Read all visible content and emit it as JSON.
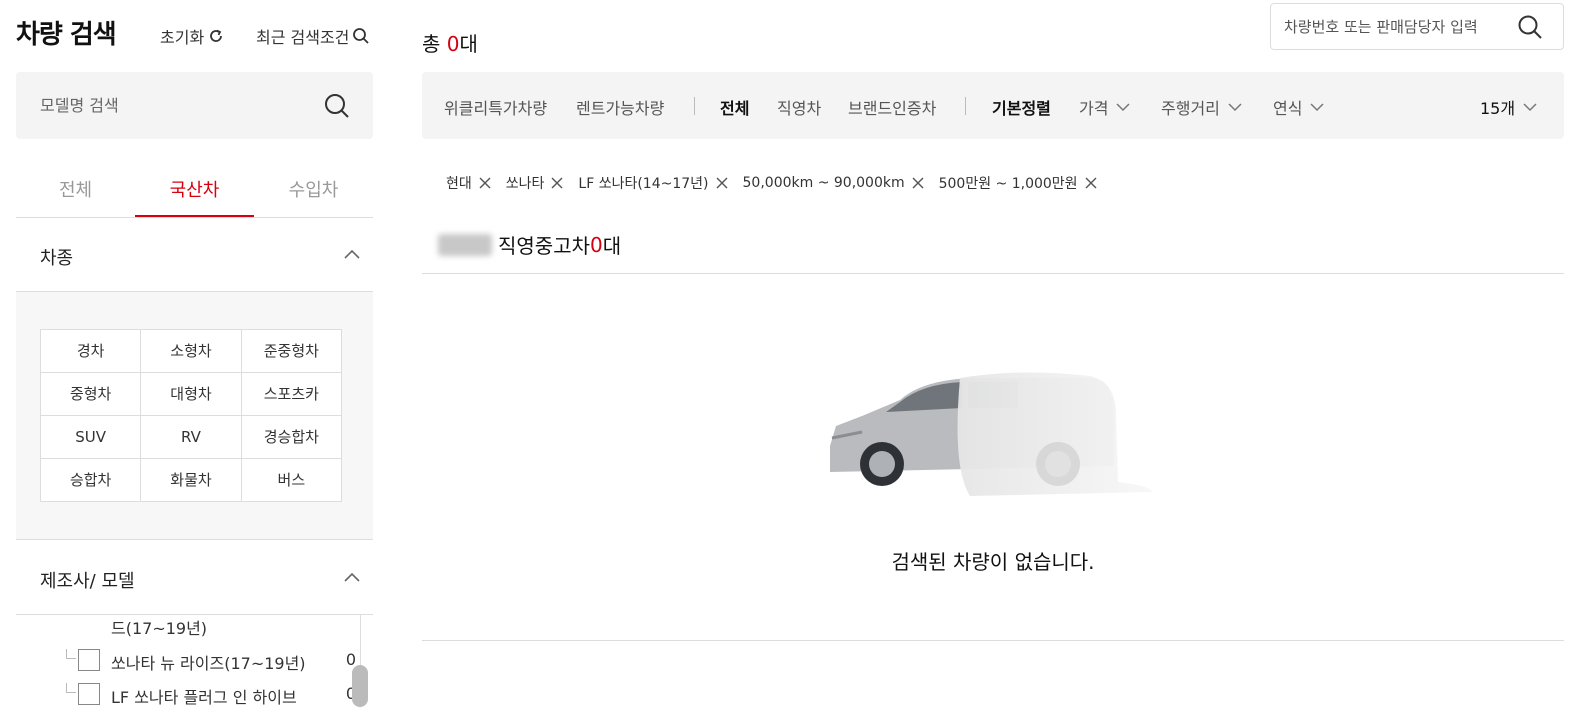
{
  "sidebar": {
    "title": "차량 검색",
    "reset_label": "초기화",
    "recent_label": "최근 검색조건",
    "model_search_placeholder": "모델명 검색",
    "origin_tabs": [
      {
        "label": "전체",
        "active": false
      },
      {
        "label": "국산차",
        "active": true
      },
      {
        "label": "수입차",
        "active": false
      }
    ],
    "car_type_section": {
      "title": "차종",
      "types": [
        "경차",
        "소형차",
        "준중형차",
        "중형차",
        "대형차",
        "스포츠카",
        "SUV",
        "RV",
        "경승합차",
        "승합차",
        "화물차",
        "버스"
      ]
    },
    "maker_section": {
      "title": "제조사/ 모델",
      "continued_text": "드(17~19년)",
      "models": [
        {
          "name": "쏘나타 뉴 라이즈(17~19년)",
          "count": "0"
        },
        {
          "name": "LF 쏘나타 플러그 인 하이브",
          "count": "0"
        }
      ]
    }
  },
  "main": {
    "total_prefix": "총 ",
    "total_count": "0",
    "total_suffix": "대",
    "top_search_placeholder": "차량번호 또는 판매담당자 입력",
    "filter_bar": {
      "weekly_special": "위클리특가차량",
      "rentable": "렌트가능차량",
      "all": "전체",
      "direct": "직영차",
      "brand_certified": "브랜드인증차",
      "default_sort": "기본정렬",
      "price": "가격",
      "mileage": "주행거리",
      "year": "연식",
      "per_page": "15개"
    },
    "active_filters": [
      "현대",
      "쏘나타",
      "LF 쏘나타(14~17년)",
      "50,000km ~ 90,000km",
      "500만원 ~ 1,000만원"
    ],
    "subhead": {
      "label": "직영중고차 ",
      "count": "0",
      "suffix": "대"
    },
    "empty_message": "검색된 차량이 없습니다."
  },
  "colors": {
    "accent": "#d7000f",
    "panel_bg": "#f4f4f4",
    "border": "#dddddd"
  }
}
